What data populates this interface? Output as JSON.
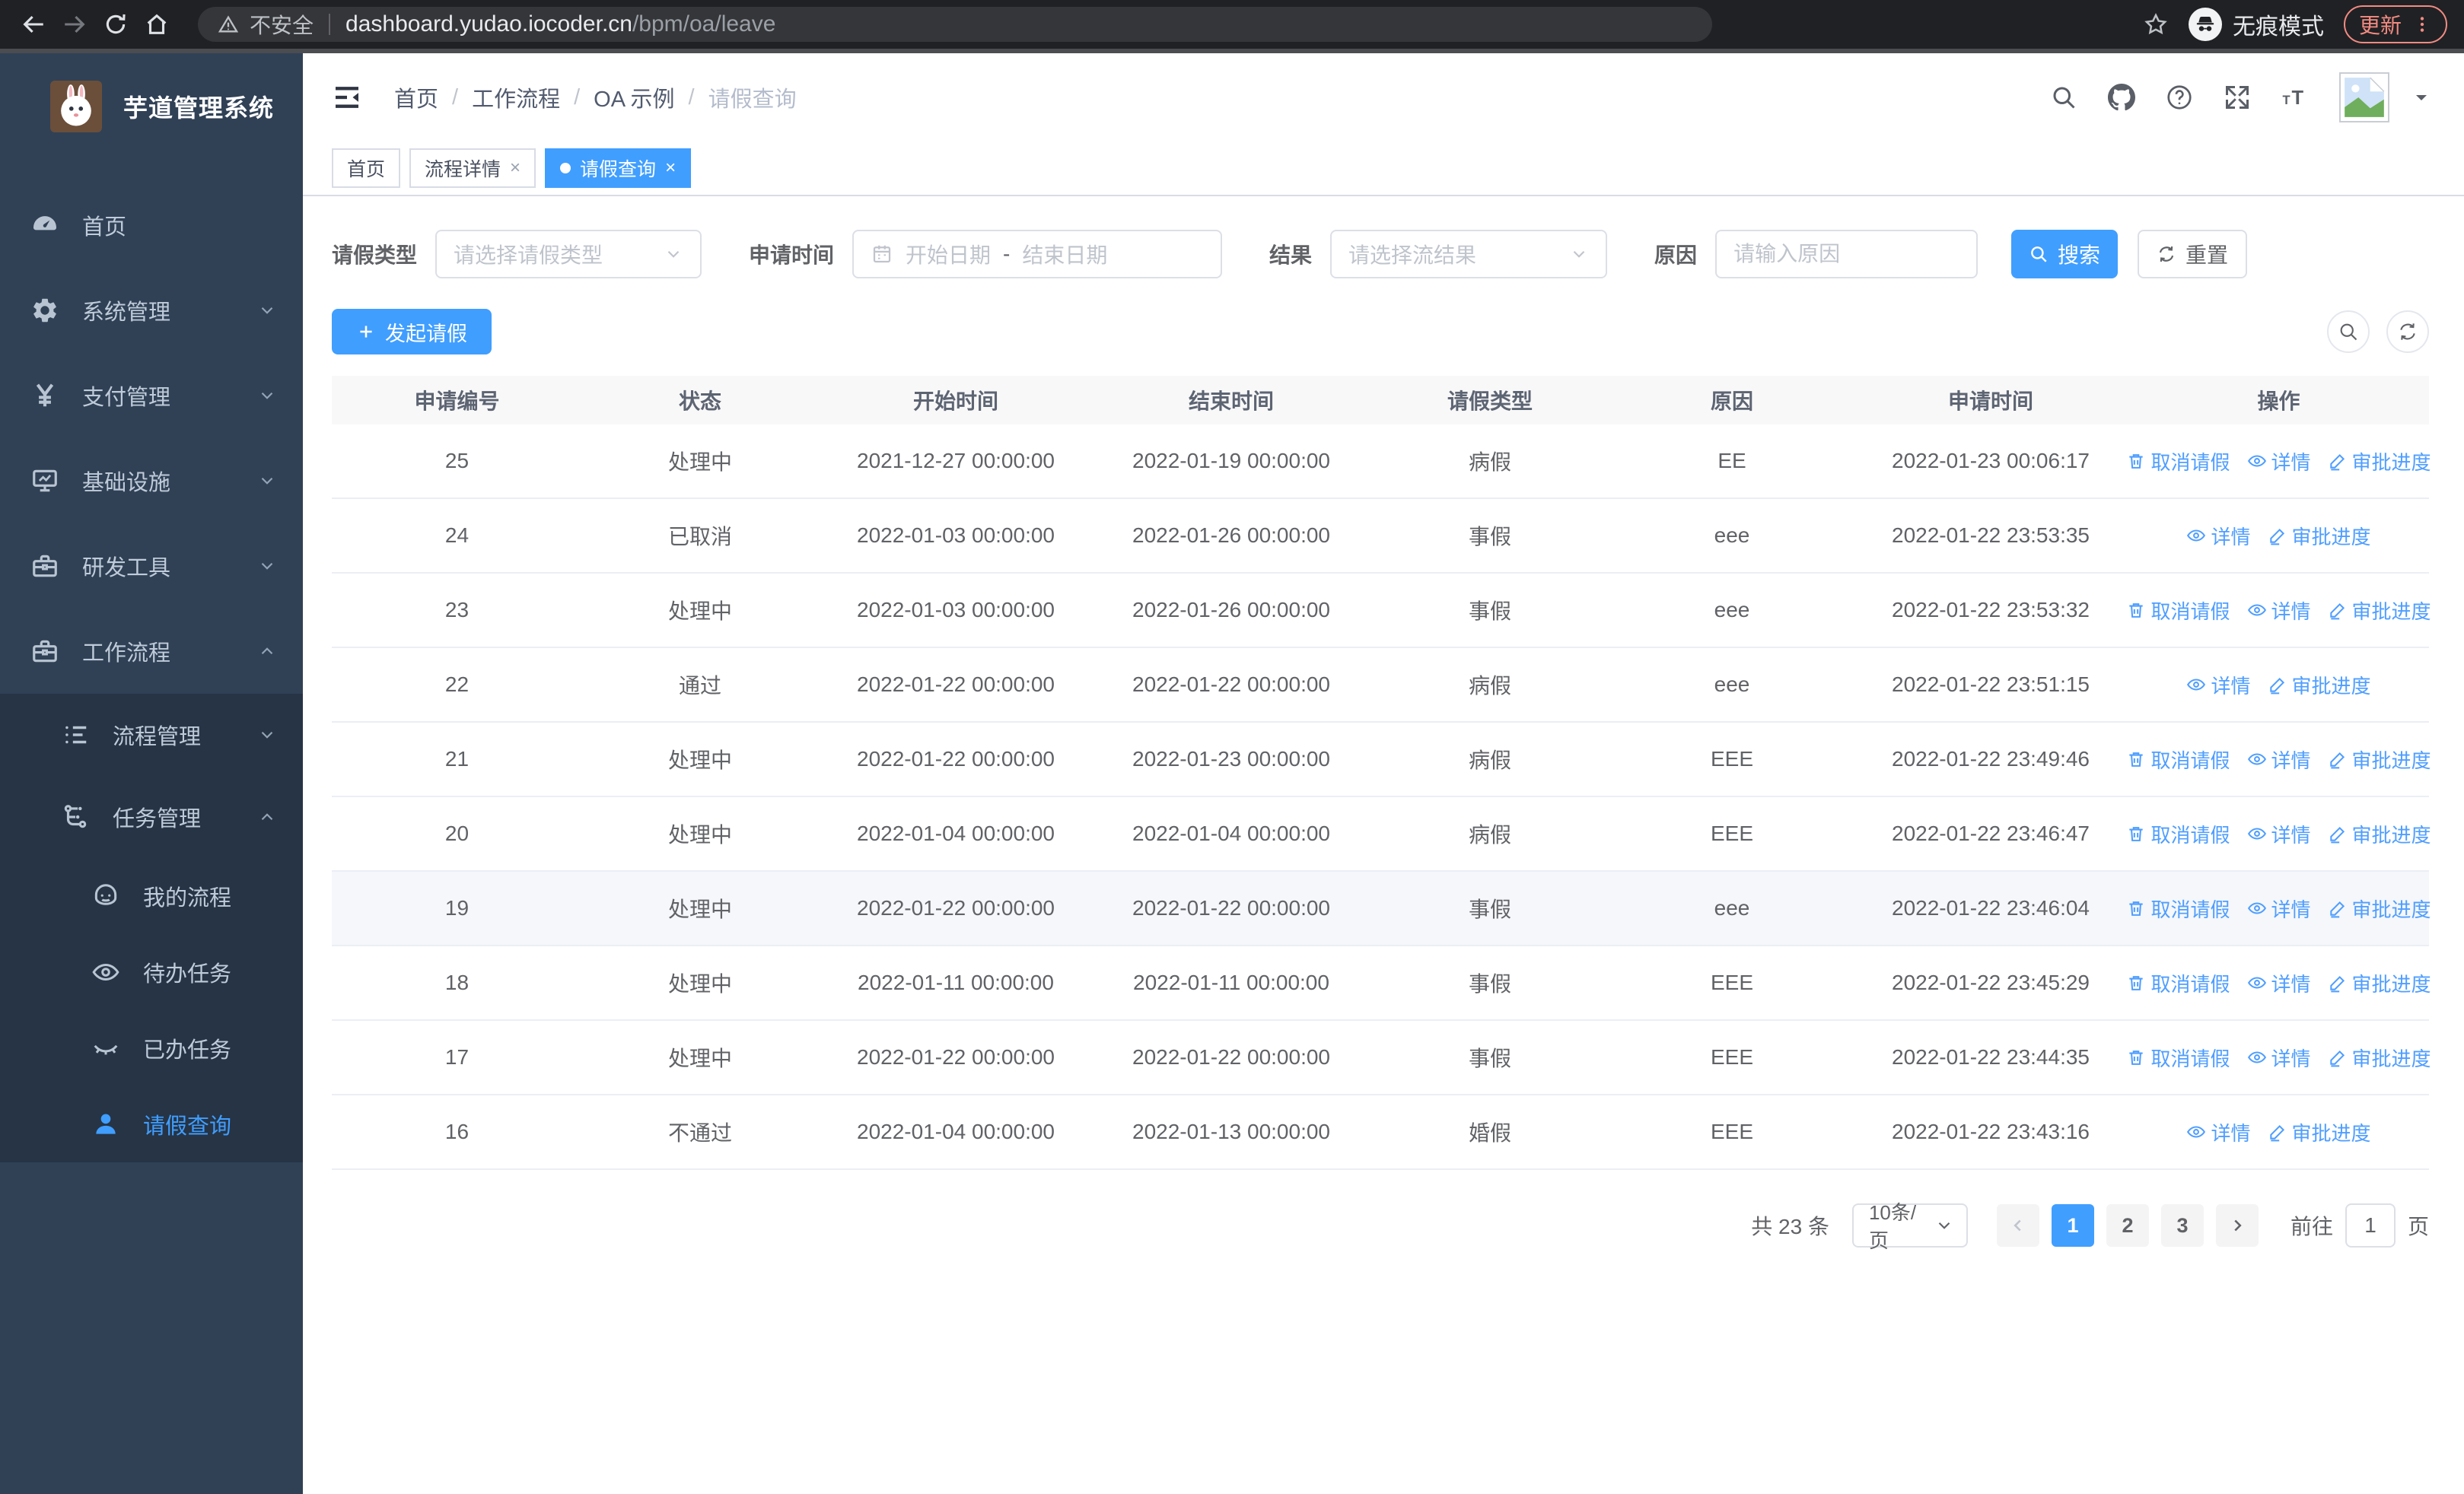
{
  "browser": {
    "security_label": "不安全",
    "url_host": "dashboard.yudao.iocoder.cn",
    "url_path": "/bpm/oa/leave",
    "incognito_label": "无痕模式",
    "update_label": "更新"
  },
  "sidebar": {
    "brand": "芋道管理系统",
    "menu": [
      {
        "label": "首页",
        "icon": "dashboard-icon"
      },
      {
        "label": "系统管理",
        "icon": "gear-icon",
        "chevron": "down"
      },
      {
        "label": "支付管理",
        "icon": "yen-icon",
        "chevron": "down"
      },
      {
        "label": "基础设施",
        "icon": "monitor-icon",
        "chevron": "down"
      },
      {
        "label": "研发工具",
        "icon": "toolbox-icon",
        "chevron": "down"
      },
      {
        "label": "工作流程",
        "icon": "briefcase-icon",
        "chevron": "up",
        "children": [
          {
            "label": "流程管理",
            "icon": "list-icon",
            "chevron": "down"
          },
          {
            "label": "任务管理",
            "icon": "tree-icon",
            "chevron": "up",
            "children": [
              {
                "label": "我的流程",
                "icon": "robot-icon"
              },
              {
                "label": "待办任务",
                "icon": "eye-open-icon"
              },
              {
                "label": "已办任务",
                "icon": "eye-closed-icon"
              },
              {
                "label": "请假查询",
                "icon": "user-icon",
                "active": true
              }
            ]
          }
        ]
      }
    ]
  },
  "header": {
    "breadcrumb": [
      "首页",
      "工作流程",
      "OA 示例",
      "请假查询"
    ],
    "tabs": [
      {
        "label": "首页",
        "closable": false,
        "active": false
      },
      {
        "label": "流程详情",
        "closable": true,
        "active": false
      },
      {
        "label": "请假查询",
        "closable": true,
        "active": true
      }
    ]
  },
  "filters": {
    "leave_type_label": "请假类型",
    "leave_type_placeholder": "请选择请假类型",
    "apply_time_label": "申请时间",
    "start_date_placeholder": "开始日期",
    "range_separator": "-",
    "end_date_placeholder": "结束日期",
    "result_label": "结果",
    "result_placeholder": "请选择流结果",
    "reason_label": "原因",
    "reason_placeholder": "请输入原因",
    "search_button": "搜索",
    "reset_button": "重置"
  },
  "toolbar": {
    "create_button": "发起请假"
  },
  "table": {
    "columns": [
      "申请编号",
      "状态",
      "开始时间",
      "结束时间",
      "请假类型",
      "原因",
      "申请时间",
      "操作"
    ],
    "action_labels": {
      "cancel": "取消请假",
      "detail": "详情",
      "progress": "审批进度"
    },
    "rows": [
      {
        "id": "25",
        "status": "处理中",
        "start": "2021-12-27 00:00:00",
        "end": "2022-01-19 00:00:00",
        "type": "病假",
        "reason": "EE",
        "apply": "2022-01-23 00:06:17",
        "can_cancel": true,
        "highlight": false
      },
      {
        "id": "24",
        "status": "已取消",
        "start": "2022-01-03 00:00:00",
        "end": "2022-01-26 00:00:00",
        "type": "事假",
        "reason": "eee",
        "apply": "2022-01-22 23:53:35",
        "can_cancel": false,
        "highlight": false
      },
      {
        "id": "23",
        "status": "处理中",
        "start": "2022-01-03 00:00:00",
        "end": "2022-01-26 00:00:00",
        "type": "事假",
        "reason": "eee",
        "apply": "2022-01-22 23:53:32",
        "can_cancel": true,
        "highlight": false
      },
      {
        "id": "22",
        "status": "通过",
        "start": "2022-01-22 00:00:00",
        "end": "2022-01-22 00:00:00",
        "type": "病假",
        "reason": "eee",
        "apply": "2022-01-22 23:51:15",
        "can_cancel": false,
        "highlight": false
      },
      {
        "id": "21",
        "status": "处理中",
        "start": "2022-01-22 00:00:00",
        "end": "2022-01-23 00:00:00",
        "type": "病假",
        "reason": "EEE",
        "apply": "2022-01-22 23:49:46",
        "can_cancel": true,
        "highlight": false
      },
      {
        "id": "20",
        "status": "处理中",
        "start": "2022-01-04 00:00:00",
        "end": "2022-01-04 00:00:00",
        "type": "病假",
        "reason": "EEE",
        "apply": "2022-01-22 23:46:47",
        "can_cancel": true,
        "highlight": false
      },
      {
        "id": "19",
        "status": "处理中",
        "start": "2022-01-22 00:00:00",
        "end": "2022-01-22 00:00:00",
        "type": "事假",
        "reason": "eee",
        "apply": "2022-01-22 23:46:04",
        "can_cancel": true,
        "highlight": true
      },
      {
        "id": "18",
        "status": "处理中",
        "start": "2022-01-11 00:00:00",
        "end": "2022-01-11 00:00:00",
        "type": "事假",
        "reason": "EEE",
        "apply": "2022-01-22 23:45:29",
        "can_cancel": true,
        "highlight": false
      },
      {
        "id": "17",
        "status": "处理中",
        "start": "2022-01-22 00:00:00",
        "end": "2022-01-22 00:00:00",
        "type": "事假",
        "reason": "EEE",
        "apply": "2022-01-22 23:44:35",
        "can_cancel": true,
        "highlight": false
      },
      {
        "id": "16",
        "status": "不通过",
        "start": "2022-01-04 00:00:00",
        "end": "2022-01-13 00:00:00",
        "type": "婚假",
        "reason": "EEE",
        "apply": "2022-01-22 23:43:16",
        "can_cancel": false,
        "highlight": false
      }
    ]
  },
  "pagination": {
    "total": "共 23 条",
    "page_size": "10条/页",
    "pages": [
      "1",
      "2",
      "3"
    ],
    "active_page": "1",
    "goto_label": "前往",
    "goto_value": "1",
    "page_suffix": "页"
  },
  "colors": {
    "accent": "#409eff",
    "sidebar_bg": "#304156",
    "submenu_bg": "#263445"
  }
}
